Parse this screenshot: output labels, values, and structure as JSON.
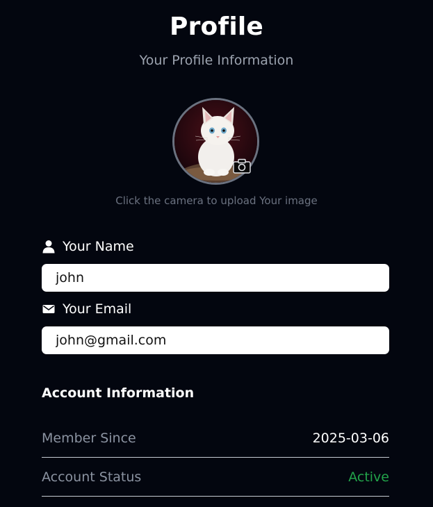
{
  "header": {
    "title": "Profile",
    "subtitle": "Your Profile Information"
  },
  "avatar": {
    "icon": "camera-icon",
    "hint": "Click the camera to upload Your image"
  },
  "form": {
    "name": {
      "label": "Your Name",
      "value": "john",
      "icon": "user-icon"
    },
    "email": {
      "label": "Your Email",
      "value": "john@gmail.com",
      "icon": "envelope-icon"
    }
  },
  "account": {
    "title": "Account Information",
    "rows": [
      {
        "label": "Member Since",
        "value": "2025-03-06"
      },
      {
        "label": "Account Status",
        "value": "Active"
      }
    ]
  },
  "colors": {
    "background": "#03060f",
    "muted": "#9ca3af",
    "active": "#22a34a"
  }
}
